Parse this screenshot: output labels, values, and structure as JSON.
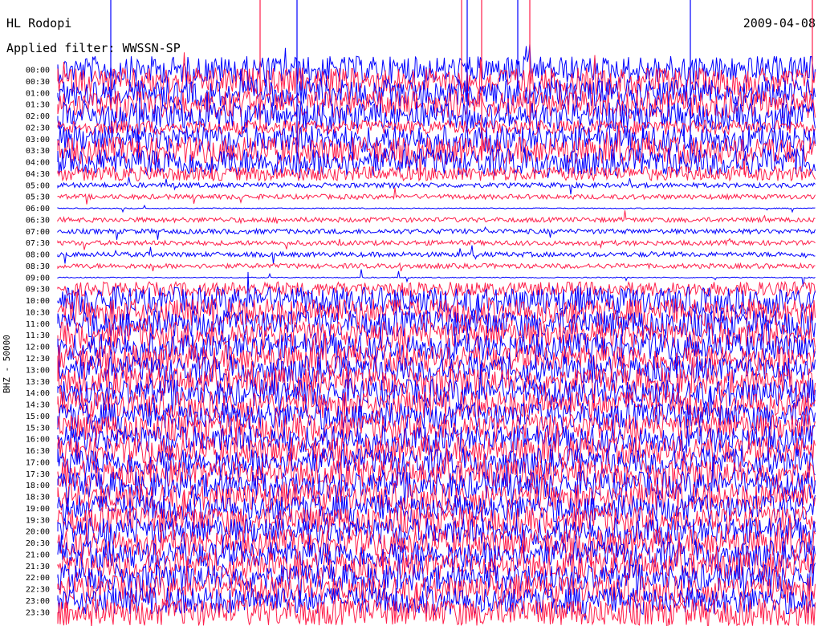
{
  "header": {
    "station": "HL Rodopi",
    "date": "2009-04-08",
    "filter": "Applied filter: WWSSN-SP"
  },
  "colors": {
    "trace_a": "#0000ff",
    "trace_b": "#ff1f4b",
    "background": "#ffffff"
  },
  "chart_data": {
    "type": "line",
    "title": "HL Rodopi",
    "ylabel": "BHZ - 50000",
    "row_labels": [
      "00:00",
      "00:30",
      "01:00",
      "01:30",
      "02:00",
      "02:30",
      "03:00",
      "03:30",
      "04:00",
      "04:30",
      "05:00",
      "05:30",
      "06:00",
      "06:30",
      "07:00",
      "07:30",
      "08:00",
      "08:30",
      "09:00",
      "09:30",
      "10:00",
      "10:30",
      "11:00",
      "11:30",
      "12:00",
      "12:30",
      "13:00",
      "13:30",
      "14:00",
      "14:30",
      "15:00",
      "15:30",
      "16:00",
      "16:30",
      "17:00",
      "17:30",
      "18:00",
      "18:30",
      "19:00",
      "19:30",
      "20:00",
      "20:30",
      "21:00",
      "21:30",
      "22:00",
      "22:30",
      "23:00",
      "23:30"
    ],
    "row_colors": [
      "blue",
      "red",
      "blue",
      "red",
      "blue",
      "red",
      "blue",
      "red",
      "blue",
      "red",
      "blue",
      "red",
      "blue",
      "red",
      "blue",
      "red",
      "blue",
      "red",
      "blue",
      "red",
      "blue",
      "red",
      "blue",
      "red",
      "blue",
      "red",
      "blue",
      "red",
      "blue",
      "red",
      "blue",
      "red",
      "blue",
      "red",
      "blue",
      "red",
      "blue",
      "red",
      "blue",
      "red",
      "blue",
      "red",
      "blue",
      "red",
      "blue",
      "red",
      "blue",
      "red"
    ],
    "row_activity": [
      3,
      3,
      3,
      3,
      3,
      2,
      3,
      3,
      3,
      2,
      1,
      1,
      0,
      1,
      1,
      1,
      1,
      1,
      0,
      2,
      3,
      3,
      3,
      3,
      3,
      3,
      3,
      3,
      3,
      3,
      3,
      3,
      3,
      3,
      3,
      3,
      3,
      3,
      3,
      3,
      3,
      3,
      3,
      3,
      3,
      3,
      3,
      3
    ]
  }
}
